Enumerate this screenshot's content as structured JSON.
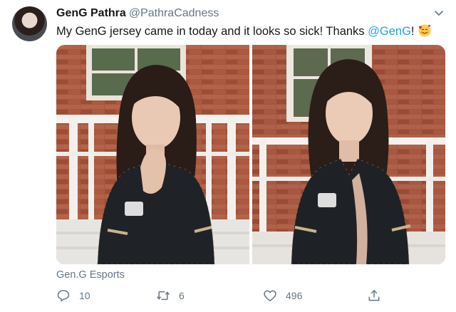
{
  "tweet": {
    "author_name": "GenG Pathra",
    "author_handle": "@PathraCadness",
    "text_before": "My GenG jersey came in today and it looks so sick! Thanks ",
    "mention": "@GenG",
    "text_after": "!",
    "source_label": "Gen.G Esports",
    "icons": {
      "menu": "chevron-down-icon",
      "reply": "reply-icon",
      "retweet": "retweet-icon",
      "like": "heart-icon",
      "share": "share-icon",
      "emoji": "smiling-face-with-hearts-icon"
    },
    "colors": {
      "link": "#1da1f2",
      "secondary_text": "#657786",
      "primary_text": "#14171a"
    }
  },
  "actions": {
    "reply_count": "10",
    "retweet_count": "6",
    "like_count": "496"
  }
}
